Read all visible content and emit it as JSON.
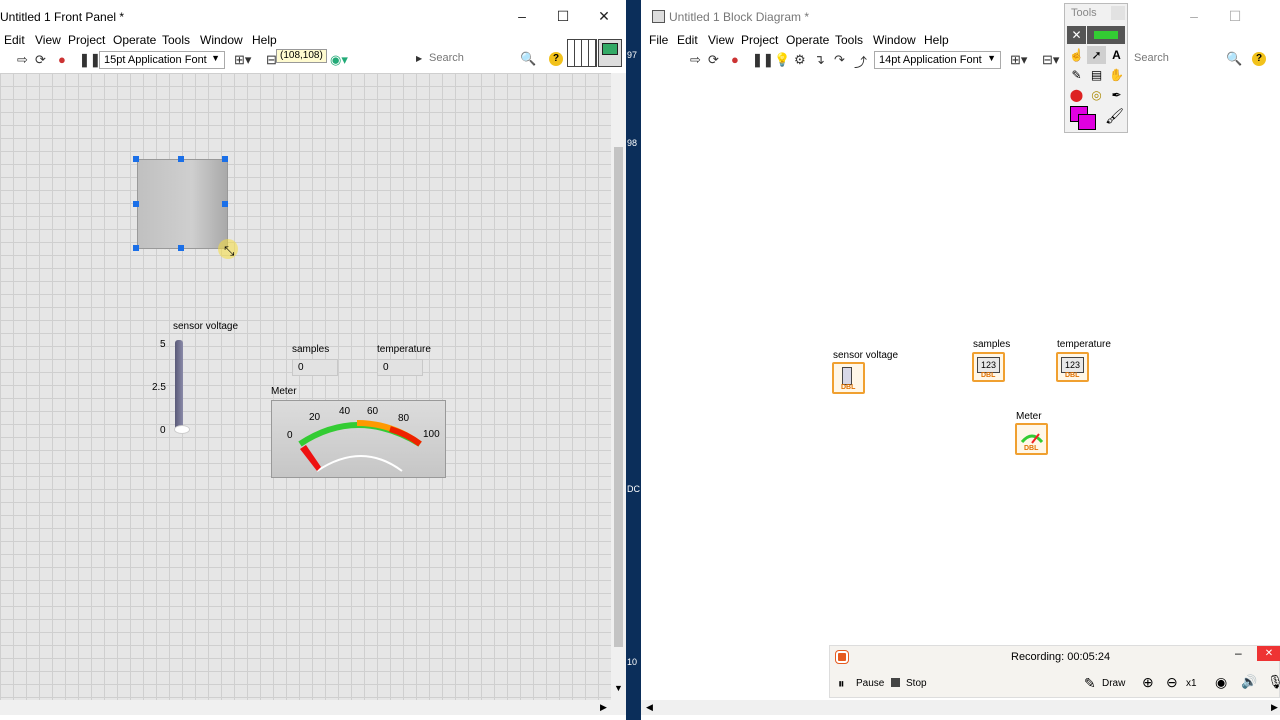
{
  "front_panel": {
    "title": "Untitled 1 Front Panel *",
    "menu": [
      "Edit",
      "View",
      "Project",
      "Operate",
      "Tools",
      "Window",
      "Help"
    ],
    "font": "15pt Application Font",
    "coords_tooltip": "(108,108)",
    "search_placeholder": "Search",
    "help_glyph": "?",
    "controls": {
      "sensor_voltage": {
        "label": "sensor voltage",
        "ticks": [
          "5",
          "2.5",
          "0"
        ],
        "value": 0
      },
      "samples": {
        "label": "samples",
        "value": "0"
      },
      "temperature": {
        "label": "temperature",
        "value": "0"
      },
      "meter": {
        "label": "Meter",
        "ticks": [
          "0",
          "20",
          "40",
          "60",
          "80",
          "100"
        ],
        "value": 0
      }
    }
  },
  "block_diagram": {
    "title": "Untitled 1 Block Diagram *",
    "menu": [
      "File",
      "Edit",
      "View",
      "Project",
      "Operate",
      "Tools",
      "Window",
      "Help"
    ],
    "font": "14pt Application Font",
    "search_placeholder": "Search",
    "help_glyph": "?",
    "terminals": {
      "sensor_voltage": "sensor voltage",
      "samples": "samples",
      "temperature": "temperature",
      "meter": "Meter",
      "type_badge": "DBL",
      "numeric_glyph": "123"
    }
  },
  "tools_palette": {
    "title": "Tools"
  },
  "recorder": {
    "status": "Recording:  00:05:24",
    "pause": "Pause",
    "stop": "Stop",
    "draw": "Draw",
    "zoom": "x1"
  },
  "desktop_strip": [
    "97",
    "98",
    "DC",
    "10"
  ],
  "colors": {
    "selection": "#1a6fe8",
    "terminal_border": "#f0a030",
    "recording_red": "#e65a1e"
  }
}
